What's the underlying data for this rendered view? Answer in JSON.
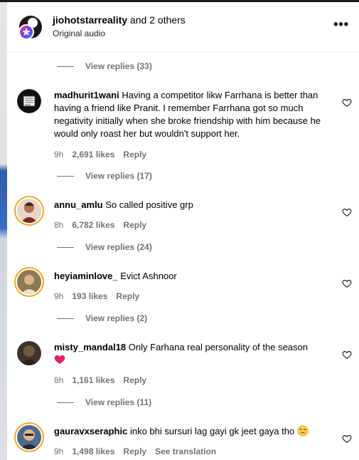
{
  "header": {
    "author": "jiohotstarreality",
    "author_suffix": " and 2 others",
    "subtitle": "Original audio"
  },
  "view_replies": [
    "View replies (33)",
    "View replies (17)",
    "View replies (24)",
    "View replies (2)",
    "View replies (11)"
  ],
  "comments": [
    {
      "user": "madhurit1wani",
      "text": "Having a competitor likw Farrhana is better than having a friend like Pranit. I remember Farrhana got so much negativity initially when she broke friendship with him because he would only roast her but wouldn't support her.",
      "time": "9h",
      "likes": "2,691 likes",
      "reply": "Reply"
    },
    {
      "user": "annu_amlu",
      "text": "So called positive grp",
      "time": "8h",
      "likes": "6,782 likes",
      "reply": "Reply"
    },
    {
      "user": "heyiaminlove_",
      "text": "Evict Ashnoor",
      "time": "9h",
      "likes": "193 likes",
      "reply": "Reply"
    },
    {
      "user": "misty_mandal18",
      "text": "Only Farhana real personality of the season",
      "emoji": "❤️",
      "time": "8h",
      "likes": "1,161 likes",
      "reply": "Reply"
    },
    {
      "user": "gauravxseraphic",
      "text": "inko bhi sursuri lag gayi gk jeet gaya tho",
      "emoji": "😒",
      "time": "9h",
      "likes": "1,498 likes",
      "reply": "Reply",
      "translate": "See translation"
    }
  ],
  "colors": {
    "heart_red": "#e0245e",
    "muted": "#737373",
    "story_ring": "#f5a623"
  }
}
